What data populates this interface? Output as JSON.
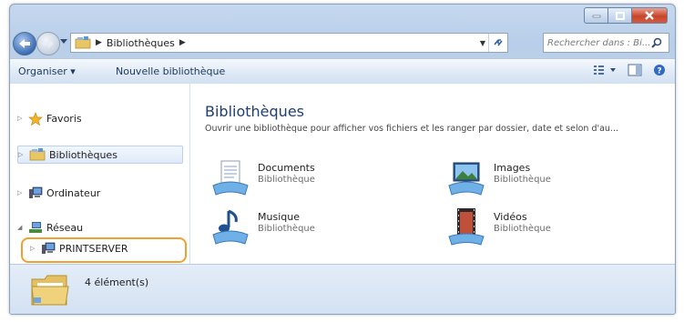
{
  "window": {
    "caption_buttons": [
      "minimize",
      "maximize",
      "close"
    ]
  },
  "address_bar": {
    "breadcrumb": "Bibliothèques",
    "search_placeholder": "Rechercher dans : Bi..."
  },
  "toolbar": {
    "organize_label": "Organiser ▾",
    "new_library_label": "Nouvelle bibliothèque"
  },
  "nav": {
    "items": [
      {
        "label": "Favoris",
        "icon": "star-icon"
      },
      {
        "label": "Bibliothèques",
        "icon": "library-icon",
        "selected": true
      },
      {
        "label": "Ordinateur",
        "icon": "computer-icon"
      },
      {
        "label": "Réseau",
        "icon": "network-icon"
      },
      {
        "label": "PRINTSERVER",
        "icon": "server-icon",
        "highlighted": true
      }
    ]
  },
  "content": {
    "title": "Bibliothèques",
    "subtitle": "Ouvrir une bibliothèque pour afficher vos fichiers et les ranger par dossier, date et selon d'au...",
    "libraries": [
      {
        "name": "Documents",
        "type": "Bibliothèque",
        "icon": "documents-icon"
      },
      {
        "name": "Images",
        "type": "Bibliothèque",
        "icon": "images-icon"
      },
      {
        "name": "Musique",
        "type": "Bibliothèque",
        "icon": "music-icon"
      },
      {
        "name": "Vidéos",
        "type": "Bibliothèque",
        "icon": "videos-icon"
      }
    ]
  },
  "status": {
    "count_text": "4 élément(s)"
  },
  "colors": {
    "highlight": "#f0a030",
    "title": "#1e3f70"
  }
}
